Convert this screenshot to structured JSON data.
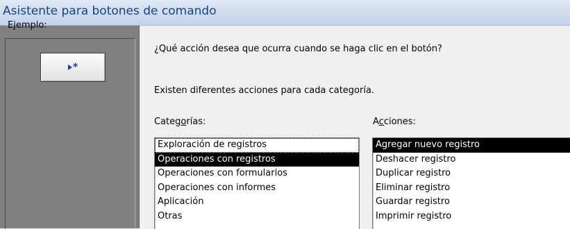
{
  "window": {
    "title": "Asistente para botones de comando"
  },
  "example": {
    "label": "Ejemplo:",
    "button_icon": "new-record-icon"
  },
  "prompt": {
    "question": "¿Qué acción desea que ocurra cuando se haga clic en el botón?",
    "info": "Existen diferentes acciones para cada categoría."
  },
  "categories": {
    "label_pre": "Categ",
    "label_mnemonic": "o",
    "label_post": "rías:",
    "items": [
      {
        "label": "Exploración de registros",
        "selected": false
      },
      {
        "label": "Operaciones con registros",
        "selected": true
      },
      {
        "label": "Operaciones con formularios",
        "selected": false
      },
      {
        "label": "Operaciones con informes",
        "selected": false
      },
      {
        "label": "Aplicación",
        "selected": false
      },
      {
        "label": "Otras",
        "selected": false
      }
    ]
  },
  "actions": {
    "label_pre": "A",
    "label_mnemonic": "c",
    "label_post": "ciones:",
    "items": [
      {
        "label": "Agregar nuevo registro",
        "selected": true
      },
      {
        "label": "Deshacer registro",
        "selected": false
      },
      {
        "label": "Duplicar registro",
        "selected": false
      },
      {
        "label": "Eliminar registro",
        "selected": false
      },
      {
        "label": "Guardar registro",
        "selected": false
      },
      {
        "label": "Imprimir registro",
        "selected": false
      }
    ]
  },
  "colors": {
    "title_text": "#15428b",
    "left_panel": "#808080",
    "selection": "#000000",
    "icon": "#1f3f8f"
  }
}
